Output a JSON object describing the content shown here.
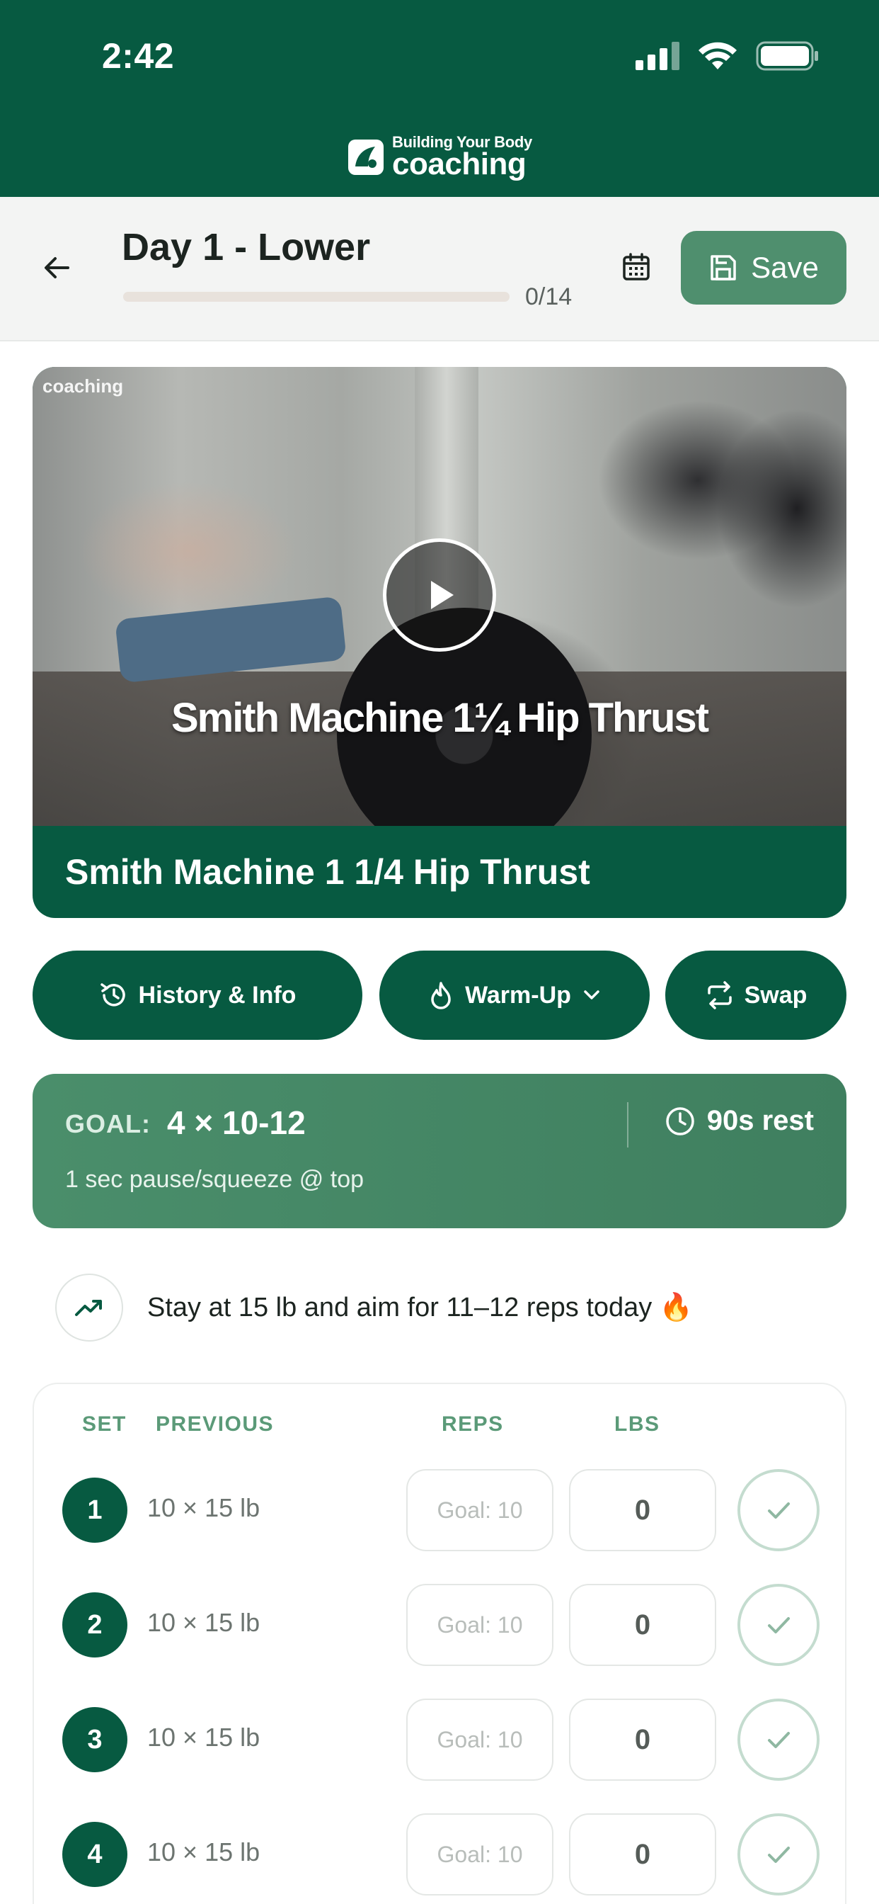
{
  "status_bar": {
    "time": "2:42"
  },
  "brand": {
    "small": "Building Your Body",
    "big": "coaching"
  },
  "workout": {
    "title": "Day 1 - Lower",
    "progress_text": "0/14",
    "progress_fraction": 0,
    "save_label": "Save"
  },
  "video": {
    "watermark": "coaching",
    "caption": "Smith Machine 1¼ Hip Thrust",
    "exercise_title": "Smith Machine 1 1/4 Hip Thrust"
  },
  "actions": {
    "history_label": "History & Info",
    "warmup_label": "Warm-Up",
    "swap_label": "Swap"
  },
  "goal": {
    "label": "GOAL:",
    "value": "4 × 10-12",
    "rest": "90s rest",
    "note": "1 sec pause/squeeze @ top"
  },
  "tip": {
    "text": "Stay at 15 lb and aim for 11–12 reps today 🔥"
  },
  "table": {
    "headers": {
      "set": "SET",
      "previous": "PREVIOUS",
      "reps": "REPS",
      "lbs": "LBS"
    },
    "rows": [
      {
        "set": "1",
        "previous": "10 × 15 lb",
        "reps_placeholder": "Goal: 10",
        "lbs": "0"
      },
      {
        "set": "2",
        "previous": "10 × 15 lb",
        "reps_placeholder": "Goal: 10",
        "lbs": "0"
      },
      {
        "set": "3",
        "previous": "10 × 15 lb",
        "reps_placeholder": "Goal: 10",
        "lbs": "0"
      },
      {
        "set": "4",
        "previous": "10 × 15 lb",
        "reps_placeholder": "Goal: 10",
        "lbs": "0"
      }
    ]
  },
  "colors": {
    "brand_green": "#075a41",
    "goal_green": "#4a8e6b",
    "save_green": "#4f8f6e"
  }
}
